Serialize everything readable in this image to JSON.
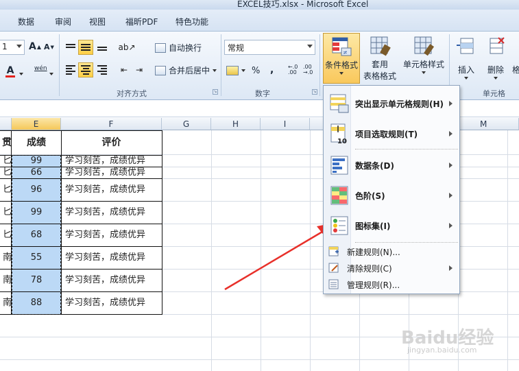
{
  "window": {
    "title": "EXCEL技巧.xlsx - Microsoft Excel"
  },
  "tabs": [
    "数据",
    "审阅",
    "视图",
    "福昕PDF",
    "特色功能"
  ],
  "ribbon": {
    "font_size": "1",
    "font_grow": "A",
    "font_shrink": "A",
    "font_color": "A",
    "phonetic": "wén",
    "wrap_text": "自动换行",
    "merge_center": "合并后居中",
    "number_format": "常规",
    "percent": "%",
    "comma": ",",
    "inc_decimal": "←.0\n.00",
    "dec_decimal": ".00\n→.0",
    "conditional_format": "条件格式",
    "format_table_line1": "套用",
    "format_table_line2": "表格格式",
    "cell_styles": "单元格样式",
    "insert": "插入",
    "delete": "删除",
    "format_cut": "格",
    "group_alignment": "对齐方式",
    "group_number": "数字",
    "group_cells": "单元格"
  },
  "columns": [
    "E",
    "F",
    "G",
    "H",
    "I",
    "M"
  ],
  "table": {
    "col_d_header_frag": "贯",
    "col_e_header": "成绩",
    "col_f_header": "评价",
    "rows": [
      {
        "d": "匕",
        "score": "99",
        "comment": "学习刻苦，成绩优异"
      },
      {
        "d": "匕",
        "score": "66",
        "comment": "学习刻苦，成绩优异"
      },
      {
        "d": "匕",
        "score": "96",
        "comment": "学习刻苦，成绩优异"
      },
      {
        "d": "匕",
        "score": "99",
        "comment": "学习刻苦，成绩优异"
      },
      {
        "d": "匕",
        "score": "68",
        "comment": "学习刻苦，成绩优异"
      },
      {
        "d": "南",
        "score": "55",
        "comment": "学习刻苦，成绩优异"
      },
      {
        "d": "南",
        "score": "78",
        "comment": "学习刻苦，成绩优异"
      },
      {
        "d": "南",
        "score": "88",
        "comment": "学习刻苦，成绩优异"
      }
    ]
  },
  "menu": {
    "items": [
      {
        "label": "突出显示单元格规则(H)",
        "icon": "highlight-rules-icon",
        "submenu": true
      },
      {
        "label": "项目选取规则(T)",
        "icon": "top-bottom-rules-icon",
        "submenu": true
      },
      {
        "label": "数据条(D)",
        "icon": "data-bars-icon",
        "submenu": true
      },
      {
        "label": "色阶(S)",
        "icon": "color-scales-icon",
        "submenu": true
      },
      {
        "label": "图标集(I)",
        "icon": "icon-sets-icon",
        "submenu": true
      },
      {
        "label": "新建规则(N)...",
        "icon": "new-rule-icon",
        "submenu": false
      },
      {
        "label": "清除规则(C)",
        "icon": "clear-rules-icon",
        "submenu": true
      },
      {
        "label": "管理规则(R)...",
        "icon": "manage-rules-icon",
        "submenu": false
      }
    ]
  },
  "watermark": {
    "brand": "Baidu经验",
    "url": "jingyan.baidu.com"
  },
  "colors": {
    "selection": "#bcd9f6",
    "arrow": "#e8302a",
    "active_button": "#ffcf45"
  }
}
